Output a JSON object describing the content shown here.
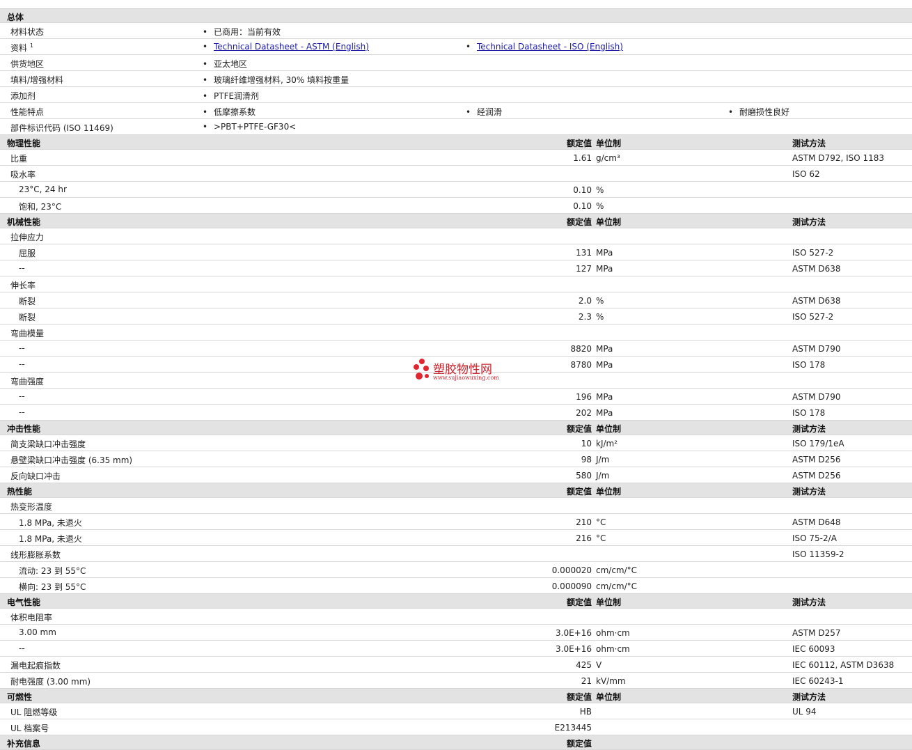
{
  "general": {
    "title": "总体",
    "rows": [
      {
        "label": "材料状态",
        "items": [
          {
            "text": "已商用：当前有效"
          }
        ]
      },
      {
        "label": "资料",
        "sup": "1",
        "items": [
          {
            "text": "Technical Datasheet - ASTM (English)",
            "link": true
          },
          {
            "text": "Technical Datasheet - ISO (English)",
            "link": true
          }
        ]
      },
      {
        "label": "供货地区",
        "items": [
          {
            "text": "亚太地区"
          }
        ]
      },
      {
        "label": "填料/增强材料",
        "items": [
          {
            "text": "玻璃纤维增强材料, 30% 填料按重量"
          }
        ]
      },
      {
        "label": "添加剂",
        "items": [
          {
            "text": "PTFE润滑剂"
          }
        ]
      },
      {
        "label": "性能特点",
        "items": [
          {
            "text": "低摩擦系数"
          },
          {
            "text": "经润滑"
          },
          {
            "text": "耐磨损性良好"
          }
        ]
      },
      {
        "label": "部件标识代码 (ISO 11469)",
        "items": [
          {
            "text": ">PBT+PTFE-GF30<"
          }
        ]
      }
    ]
  },
  "sections": [
    {
      "title": "物理性能",
      "h_value": "额定值",
      "h_unit": "单位制",
      "h_method": "测试方法",
      "rows": [
        {
          "label": "比重",
          "value": "1.61",
          "unit": "g/cm³",
          "method": "ASTM D792, ISO 1183"
        },
        {
          "label": "吸水率",
          "value": "",
          "unit": "",
          "method": "ISO 62"
        },
        {
          "label": "23°C, 24 hr",
          "indent": true,
          "value": "0.10",
          "unit": "%",
          "method": ""
        },
        {
          "label": "饱和, 23°C",
          "indent": true,
          "value": "0.10",
          "unit": "%",
          "method": ""
        }
      ]
    },
    {
      "title": "机械性能",
      "h_value": "额定值",
      "h_unit": "单位制",
      "h_method": "测试方法",
      "rows": [
        {
          "label": "拉伸应力",
          "value": "",
          "unit": "",
          "method": ""
        },
        {
          "label": "屈服",
          "indent": true,
          "value": "131",
          "unit": "MPa",
          "method": "ISO 527-2"
        },
        {
          "label": "--",
          "indent": true,
          "value": "127",
          "unit": "MPa",
          "method": "ASTM D638"
        },
        {
          "label": "伸长率",
          "value": "",
          "unit": "",
          "method": ""
        },
        {
          "label": "断裂",
          "indent": true,
          "value": "2.0",
          "unit": "%",
          "method": "ASTM D638"
        },
        {
          "label": "断裂",
          "indent": true,
          "value": "2.3",
          "unit": "%",
          "method": "ISO 527-2"
        },
        {
          "label": "弯曲模量",
          "value": "",
          "unit": "",
          "method": ""
        },
        {
          "label": "--",
          "indent": true,
          "value": "8820",
          "unit": "MPa",
          "method": "ASTM D790"
        },
        {
          "label": "--",
          "indent": true,
          "value": "8780",
          "unit": "MPa",
          "method": "ISO 178"
        },
        {
          "label": "弯曲强度",
          "value": "",
          "unit": "",
          "method": ""
        },
        {
          "label": "--",
          "indent": true,
          "value": "196",
          "unit": "MPa",
          "method": "ASTM D790"
        },
        {
          "label": "--",
          "indent": true,
          "value": "202",
          "unit": "MPa",
          "method": "ISO 178"
        }
      ]
    },
    {
      "title": "冲击性能",
      "h_value": "额定值",
      "h_unit": "单位制",
      "h_method": "测试方法",
      "rows": [
        {
          "label": "简支梁缺口冲击强度",
          "value": "10",
          "unit": "kJ/m²",
          "method": "ISO 179/1eA"
        },
        {
          "label": "悬壁梁缺口冲击强度 (6.35 mm)",
          "value": "98",
          "unit": "J/m",
          "method": "ASTM D256"
        },
        {
          "label": "反向缺口冲击",
          "value": "580",
          "unit": "J/m",
          "method": "ASTM D256"
        }
      ]
    },
    {
      "title": "热性能",
      "h_value": "额定值",
      "h_unit": "单位制",
      "h_method": "测试方法",
      "rows": [
        {
          "label": "热变形温度",
          "value": "",
          "unit": "",
          "method": ""
        },
        {
          "label": "1.8 MPa, 未退火",
          "indent": true,
          "value": "210",
          "unit": "°C",
          "method": "ASTM D648"
        },
        {
          "label": "1.8 MPa, 未退火",
          "indent": true,
          "value": "216",
          "unit": "°C",
          "method": "ISO 75-2/A"
        },
        {
          "label": "线形膨胀系数",
          "value": "",
          "unit": "",
          "method": "ISO 11359-2"
        },
        {
          "label": "流动: 23 到  55°C",
          "indent": true,
          "value": "0.000020",
          "unit": "cm/cm/°C",
          "method": ""
        },
        {
          "label": "横向: 23 到  55°C",
          "indent": true,
          "value": "0.000090",
          "unit": "cm/cm/°C",
          "method": ""
        }
      ]
    },
    {
      "title": "电气性能",
      "h_value": "额定值",
      "h_unit": "单位制",
      "h_method": "测试方法",
      "rows": [
        {
          "label": "体积电阻率",
          "value": "",
          "unit": "",
          "method": ""
        },
        {
          "label": "3.00 mm",
          "indent": true,
          "value": "3.0E+16",
          "unit": "ohm·cm",
          "method": "ASTM D257"
        },
        {
          "label": "--",
          "indent": true,
          "value": "3.0E+16",
          "unit": "ohm·cm",
          "method": "IEC 60093"
        },
        {
          "label": "漏电起痕指数",
          "value": "425",
          "unit": "V",
          "method": "IEC 60112, ASTM D3638"
        },
        {
          "label": "耐电强度 (3.00 mm)",
          "value": "21",
          "unit": "kV/mm",
          "method": "IEC 60243-1"
        }
      ]
    },
    {
      "title": "可燃性",
      "h_value": "额定值",
      "h_unit": "单位制",
      "h_method": "测试方法",
      "rows": [
        {
          "label": "UL 阻燃等级",
          "value": "HB",
          "unit": "",
          "method": "UL 94"
        },
        {
          "label": "UL 档案号",
          "value": "E213445",
          "unit": "",
          "method": ""
        }
      ]
    },
    {
      "title": "补充信息",
      "h_value": "额定值",
      "h_unit": "",
      "h_method": "",
      "rows": []
    }
  ],
  "watermark": {
    "name": "塑胶物性网",
    "url": "www.sujiaowuxing.com"
  }
}
